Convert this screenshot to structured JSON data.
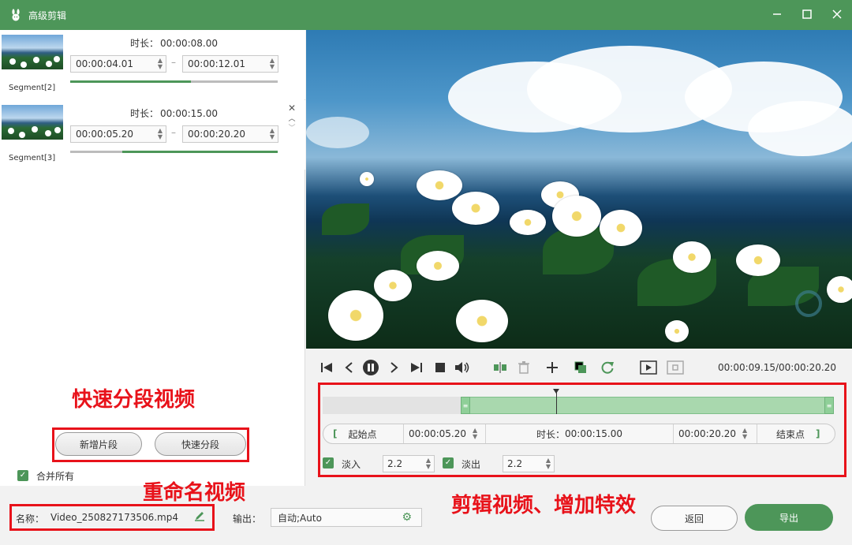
{
  "window": {
    "title": "高级剪辑",
    "icon": "rabbit-icon",
    "controls": [
      "minimize-icon",
      "maximize-icon",
      "close-icon"
    ]
  },
  "segments": [
    {
      "label": "Segment[2]",
      "duration_label": "时长：",
      "duration": "00:00:08.00",
      "start": "00:00:04.01",
      "end": "00:00:12.01",
      "progress_start": 0,
      "progress_end": 0.58
    },
    {
      "label": "Segment[3]",
      "duration_label": "时长：",
      "duration": "00:00:15.00",
      "start": "00:00:05.20",
      "end": "00:00:20.20",
      "progress_start": 0.25,
      "progress_end": 1.0
    }
  ],
  "left_buttons": {
    "add_segment": "新增片段",
    "quick_split": "快速分段"
  },
  "merge_all": {
    "label": "合并所有",
    "checked": true
  },
  "annotations": {
    "quick_split": "快速分段视频",
    "rename": "重命名视频",
    "edit": "剪辑视频、增加特效"
  },
  "player": {
    "time_display": "00:00:09.15/00:00:20.20",
    "controls": [
      "skip-start-icon",
      "step-back-icon",
      "pause-icon",
      "step-forward-icon",
      "skip-end-icon",
      "stop-icon",
      "volume-icon",
      "split-icon",
      "delete-icon",
      "add-icon",
      "copy-icon",
      "reset-icon",
      "play-selection-icon",
      "snapshot-icon"
    ]
  },
  "timeline": {
    "selection_start": 0.27,
    "selection_end": 1.0,
    "playhead": 0.457
  },
  "range": {
    "start_btn": "起始点",
    "start_value": "00:00:05.20",
    "duration_label": "时长：",
    "duration_value": "00:00:15.00",
    "end_value": "00:00:20.20",
    "end_btn": "结束点"
  },
  "fade": {
    "fade_in_label": "淡入",
    "fade_in_value": "2.2",
    "fade_out_label": "淡出",
    "fade_out_value": "2.2"
  },
  "bottom": {
    "name_label": "名称：",
    "name_value": "Video_250827173506.mp4",
    "output_label": "输出：",
    "output_value": "自动;Auto",
    "back_btn": "返回",
    "export_btn": "导出"
  },
  "colors": {
    "accent": "#4d9659",
    "annotation": "#e8121a"
  }
}
